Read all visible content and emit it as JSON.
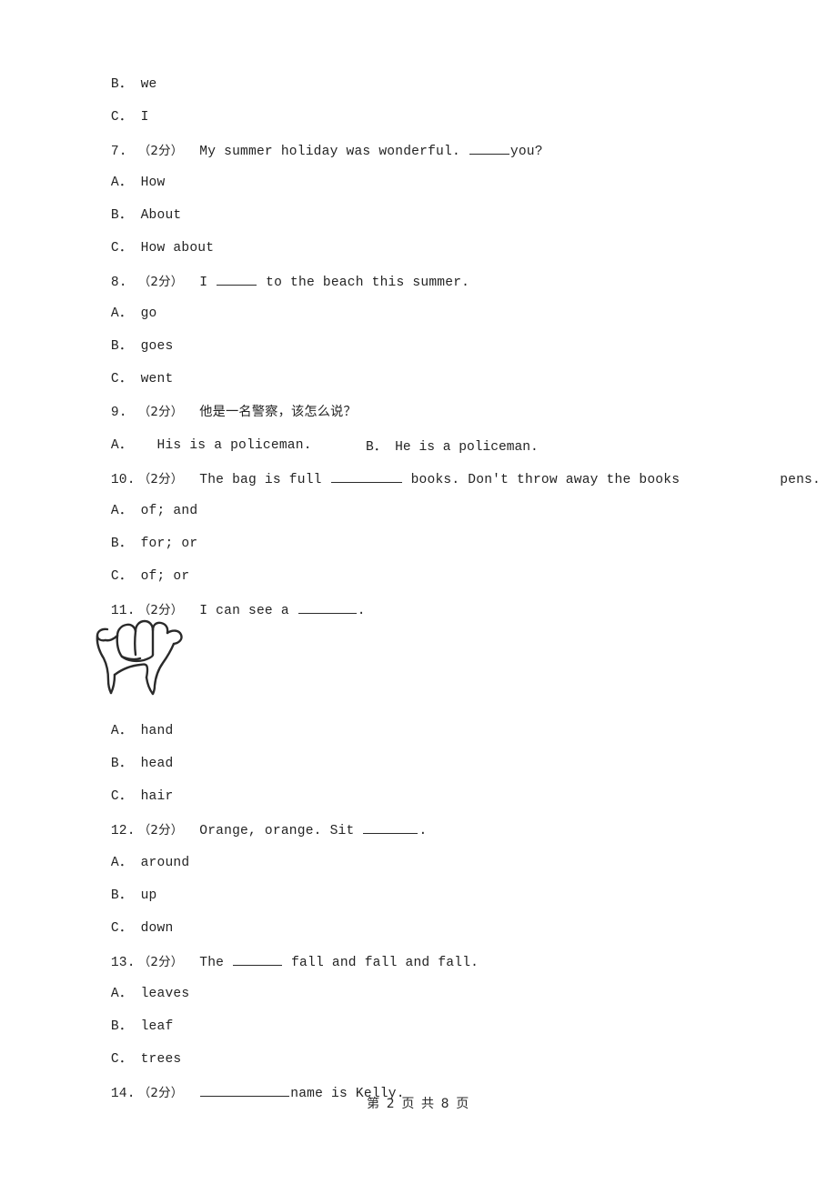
{
  "document": {
    "type": "english-exam-worksheet",
    "language_mix": "English with Chinese instructions",
    "page_background": "#ffffff",
    "text_color": "#232323"
  },
  "footer": {
    "page_indicator": "第 2 页 共 8 页",
    "current_page": "2",
    "total_pages": "8"
  },
  "score_tag": "（2分）",
  "carryover_options": [
    {
      "letter": "B",
      "sep": "．",
      "text": "we"
    },
    {
      "letter": "C",
      "sep": "．",
      "text": "I"
    }
  ],
  "questions": [
    {
      "number": "7.",
      "score": "（2分）",
      "stem_before": "My summer holiday was wonderful.",
      "stem_blank": true,
      "stem_after": "you?",
      "options": [
        {
          "letter": "A",
          "sep": "．",
          "text": "How"
        },
        {
          "letter": "B",
          "sep": "．",
          "text": "About"
        },
        {
          "letter": "C",
          "sep": "．",
          "text": "How about"
        }
      ]
    },
    {
      "number": "8.",
      "score": "（2分）",
      "stem_before": "I",
      "stem_blank": true,
      "stem_after": "to the beach this summer.",
      "options": [
        {
          "letter": "A",
          "sep": "．",
          "text": "go"
        },
        {
          "letter": "B",
          "sep": "．",
          "text": "goes"
        },
        {
          "letter": "C",
          "sep": "．",
          "text": "went"
        }
      ]
    },
    {
      "number": "9.",
      "score": "（2分）",
      "stem_chinese": "他是一名警察，该怎么说？",
      "options_inline": [
        {
          "letter": "A",
          "sep": "．",
          "text": "His is a policeman."
        },
        {
          "letter": "B",
          "sep": "．",
          "text": "He is a policeman."
        }
      ]
    },
    {
      "number": "10.",
      "score": "（2分）",
      "stem_before": "The bag is full",
      "stem_blank": true,
      "stem_mid": "books. Don't throw away the books",
      "stem_gap": true,
      "stem_after": "pens.",
      "options": [
        {
          "letter": "A",
          "sep": "．",
          "text": "of; and"
        },
        {
          "letter": "B",
          "sep": "．",
          "text": "for; or"
        },
        {
          "letter": "C",
          "sep": "．",
          "text": "of; or"
        }
      ]
    },
    {
      "number": "11.",
      "score": "（2分）",
      "stem_before": "I can see a",
      "stem_blank": true,
      "stem_after": ".",
      "image": {
        "name": "hand-line-drawing",
        "alt": "line drawing of a hand making a shaka / ASL-Y gesture"
      },
      "options": [
        {
          "letter": "A",
          "sep": "．",
          "text": "hand"
        },
        {
          "letter": "B",
          "sep": "．",
          "text": "head"
        },
        {
          "letter": "C",
          "sep": "．",
          "text": "hair"
        }
      ]
    },
    {
      "number": "12.",
      "score": "（2分）",
      "stem_before": "Orange, orange. Sit",
      "stem_blank": true,
      "stem_after": ".",
      "options": [
        {
          "letter": "A",
          "sep": "．",
          "text": "around"
        },
        {
          "letter": "B",
          "sep": "．",
          "text": "up"
        },
        {
          "letter": "C",
          "sep": "．",
          "text": "down"
        }
      ]
    },
    {
      "number": "13.",
      "score": "（2分）",
      "stem_before": "The",
      "stem_blank": true,
      "stem_after": "fall and fall and fall.",
      "options": [
        {
          "letter": "A",
          "sep": "．",
          "text": "leaves"
        },
        {
          "letter": "B",
          "sep": "．",
          "text": "leaf"
        },
        {
          "letter": "C",
          "sep": "．",
          "text": "trees"
        }
      ]
    },
    {
      "number": "14.",
      "score": "（2分）",
      "stem_before": "",
      "stem_blank": true,
      "stem_after": "name is Kelly.",
      "options": []
    }
  ]
}
